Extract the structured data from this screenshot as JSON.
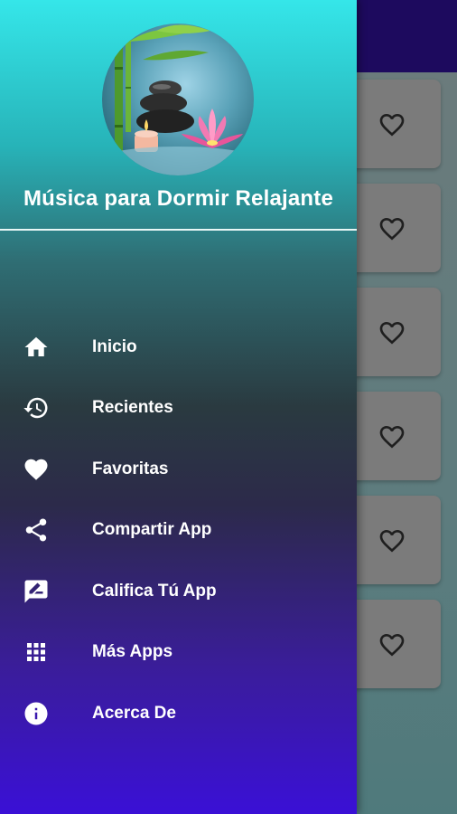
{
  "drawer": {
    "title": "Música para Dormir Relajante",
    "menu": [
      {
        "label": "Inicio",
        "icon": "home-icon"
      },
      {
        "label": "Recientes",
        "icon": "history-icon"
      },
      {
        "label": "Favoritas",
        "icon": "heart-icon"
      },
      {
        "label": "Compartir App",
        "icon": "share-icon"
      },
      {
        "label": "Califica Tú App",
        "icon": "rate-review-icon"
      },
      {
        "label": "Más Apps",
        "icon": "apps-grid-icon"
      },
      {
        "label": "Acerca De",
        "icon": "info-icon"
      }
    ]
  },
  "background_list": {
    "cards": [
      {
        "icon": "heart-outline-icon"
      },
      {
        "icon": "heart-outline-icon"
      },
      {
        "icon": "heart-outline-icon"
      },
      {
        "icon": "heart-outline-icon"
      },
      {
        "icon": "heart-outline-icon"
      },
      {
        "icon": "heart-outline-icon"
      }
    ]
  },
  "colors": {
    "topbar": "#1d0a5e",
    "drawer_top": "#35e6e9",
    "drawer_bottom": "#3a10d6",
    "text": "#ffffff"
  }
}
